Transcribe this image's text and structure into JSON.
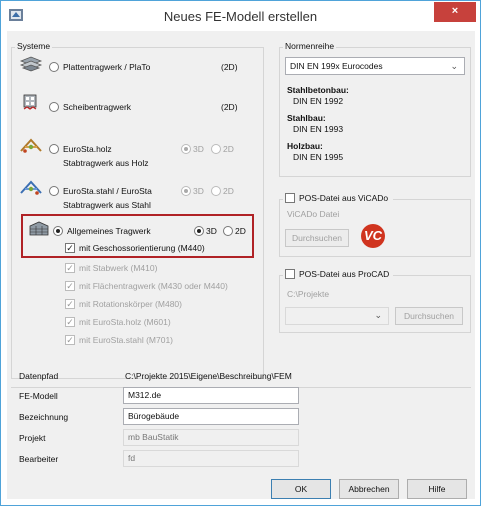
{
  "window": {
    "title": "Neues FE-Modell erstellen",
    "close_label": "×"
  },
  "systeme": {
    "label": "Systeme",
    "items": [
      {
        "label": "Plattentragwerk  / PlaTo",
        "tag": "(2D)",
        "selected": false
      },
      {
        "label": "Scheibentragwerk",
        "tag": "(2D)",
        "selected": false
      },
      {
        "label": "EuroSta.holz",
        "sub": "Stabtragwerk aus Holz",
        "opt3d": "3D",
        "opt2d": "2D",
        "selected": false
      },
      {
        "label": "EuroSta.stahl / EuroSta",
        "sub": "Stabtragwerk aus Stahl",
        "opt3d": "3D",
        "opt2d": "2D",
        "selected": false
      },
      {
        "label": "Allgemeines Tragwerk",
        "opt3d": "3D",
        "opt2d": "2D",
        "selected": true
      }
    ],
    "checkboxes": [
      {
        "label": "mit Geschossorientierung (M440)",
        "enabled": true
      },
      {
        "label": "mit Stabwerk (M410)",
        "enabled": false
      },
      {
        "label": "mit Flächentragwerk (M430 oder M440)",
        "enabled": false
      },
      {
        "label": "mit Rotationskörper (M480)",
        "enabled": false
      },
      {
        "label": "mit EuroSta.holz (M601)",
        "enabled": false
      },
      {
        "label": "mit EuroSta.stahl (M701)",
        "enabled": false
      }
    ]
  },
  "normenreihe": {
    "label": "Normenreihe",
    "selected": "DIN EN 199x Eurocodes",
    "stahlbeton_label": "Stahlbetonbau:",
    "stahlbeton_value": "DIN EN 1992",
    "stahl_label": "Stahlbau:",
    "stahl_value": "DIN EN 1993",
    "holz_label": "Holzbau:",
    "holz_value": "DIN EN 1995"
  },
  "vicado": {
    "checkbox_label": "POS-Datei aus ViCADo",
    "file_label": "ViCADo Datei",
    "browse_label": "Durchsuchen",
    "logo_text": "VC"
  },
  "procad": {
    "checkbox_label": "POS-Datei aus ProCAD",
    "path_label": "C:\\Projekte",
    "browse_label": "Durchsuchen"
  },
  "form": {
    "datenpfad_label": "Datenpfad",
    "datenpfad_value": "C:\\Projekte 2015\\Eigene\\Beschreibung\\FEM",
    "fe_modell_label": "FE-Modell",
    "fe_modell_value": "M312.de",
    "bezeichnung_label": "Bezeichnung",
    "bezeichnung_value": "Bürogebäude",
    "projekt_label": "Projekt",
    "projekt_value": "mb BauStatik",
    "bearbeiter_label": "Bearbeiter",
    "bearbeiter_value": "fd"
  },
  "buttons": {
    "ok": "OK",
    "cancel": "Abbrechen",
    "help": "Hilfe"
  },
  "colors": {
    "highlight": "#b02226",
    "close": "#c7413c",
    "border_accent": "#4fa3d9"
  }
}
